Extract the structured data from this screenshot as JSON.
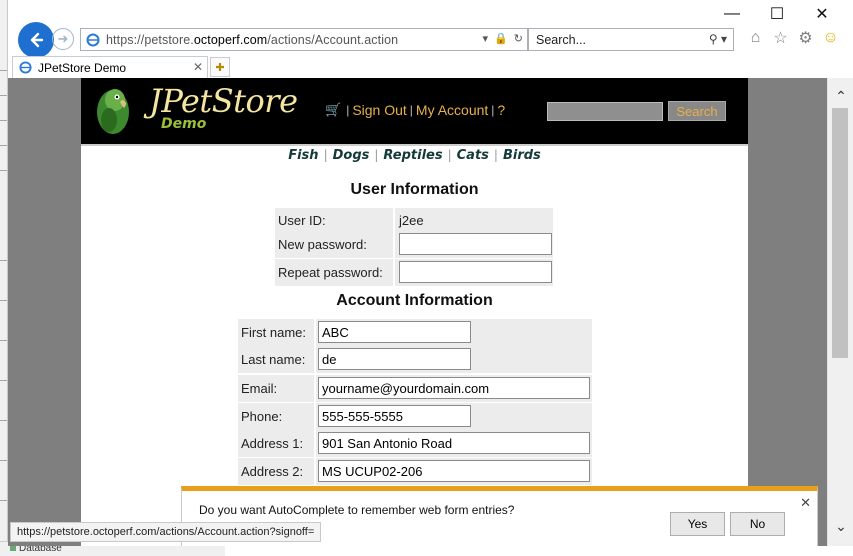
{
  "browser": {
    "url_prefix": "https://petstore.",
    "url_host": "octoperf.com",
    "url_path": "/actions/Account.action",
    "search_placeholder": "Search...",
    "tab_title": "JPetStore Demo"
  },
  "site": {
    "logo_title": "JPetStore",
    "logo_subtitle": "Demo",
    "header_links": [
      "Sign Out",
      "My Account",
      "?"
    ],
    "search_button": "Search",
    "categories": [
      "Fish",
      "Dogs",
      "Reptiles",
      "Cats",
      "Birds"
    ]
  },
  "user_info": {
    "title": "User Information",
    "user_id_label": "User ID:",
    "user_id_value": "j2ee",
    "new_password_label": "New password:",
    "repeat_password_label": "Repeat password:"
  },
  "account_info": {
    "title": "Account Information",
    "fields": [
      {
        "label": "First name:",
        "value": "ABC"
      },
      {
        "label": "Last name:",
        "value": "de"
      },
      {
        "label": "Email:",
        "value": "yourname@yourdomain.com"
      },
      {
        "label": "Phone:",
        "value": "555-555-5555"
      },
      {
        "label": "Address 1:",
        "value": "901 San Antonio Road"
      },
      {
        "label": "Address 2:",
        "value": "MS UCUP02-206"
      }
    ]
  },
  "autocomplete": {
    "message": "Do you want AutoComplete to remember web form entries?",
    "yes_label": "Yes",
    "no_label": "No"
  },
  "status": {
    "url": "https://petstore.octoperf.com/actions/Account.action?signoff="
  },
  "background": {
    "bottom_label": "Database"
  },
  "colors": {
    "accent_link": "#e8b04a",
    "header_bg": "#000000",
    "notification_bar": "#e8a01c"
  }
}
